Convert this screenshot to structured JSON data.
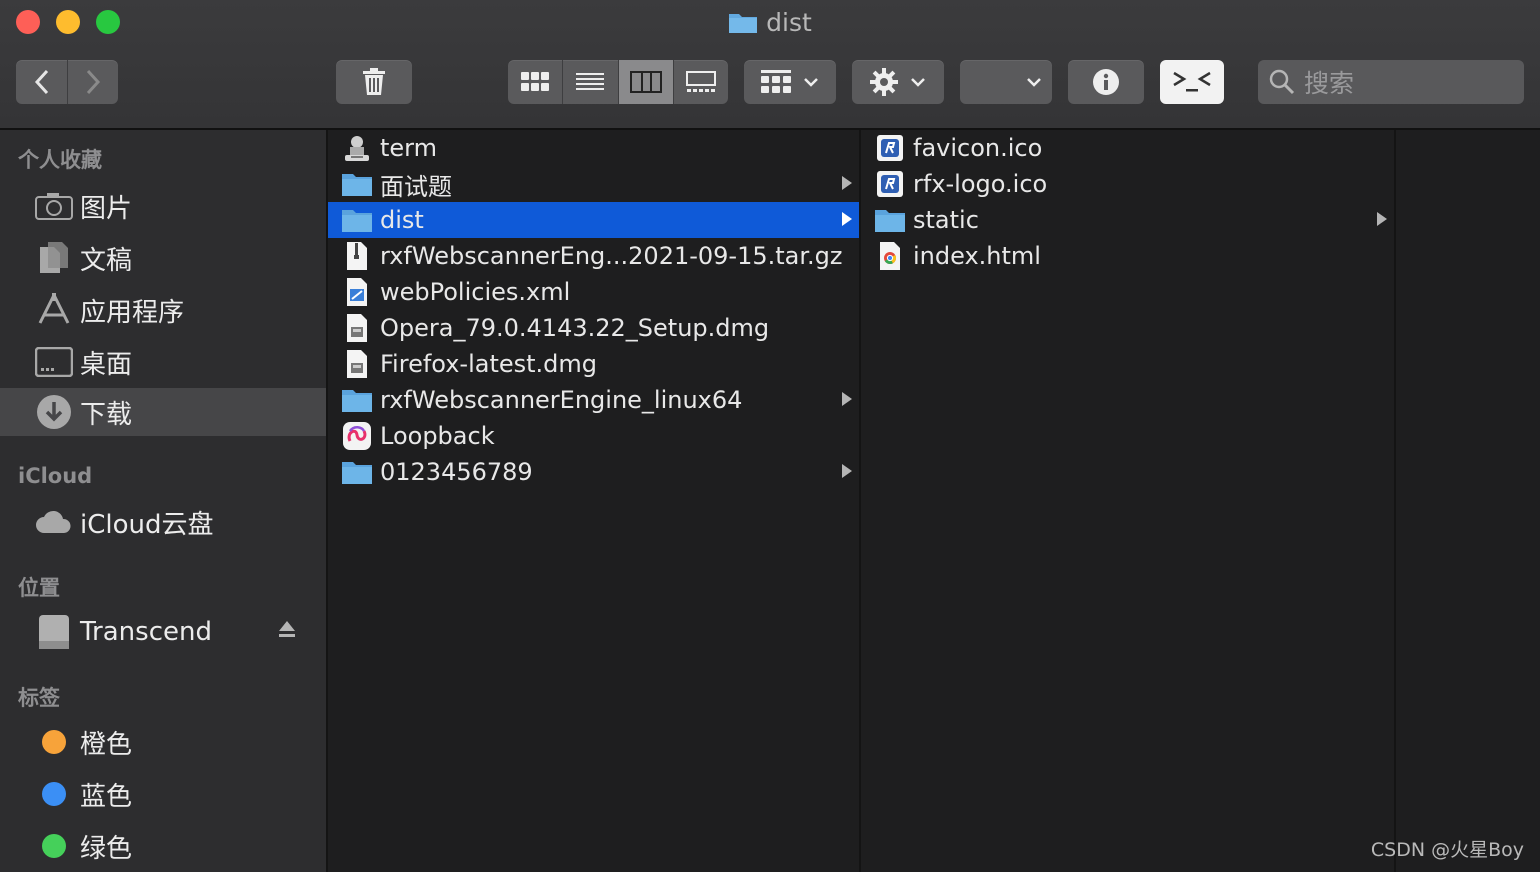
{
  "window": {
    "title": "dist"
  },
  "search": {
    "placeholder": "搜索"
  },
  "sidebar": {
    "sections": [
      {
        "heading": "个人收藏"
      },
      {
        "heading": "iCloud"
      },
      {
        "heading": "位置"
      },
      {
        "heading": "标签"
      }
    ],
    "favorites": [
      {
        "label": "图片",
        "icon": "camera-icon"
      },
      {
        "label": "文稿",
        "icon": "document-icon"
      },
      {
        "label": "应用程序",
        "icon": "applications-icon"
      },
      {
        "label": "桌面",
        "icon": "desktop-icon"
      },
      {
        "label": "下载",
        "icon": "download-icon",
        "selected": true
      }
    ],
    "icloud": [
      {
        "label": "iCloud云盘",
        "icon": "cloud-icon"
      }
    ],
    "locations": [
      {
        "label": "Transcend",
        "icon": "drive-icon"
      }
    ],
    "tags": [
      {
        "label": "橙色",
        "color": "#f7a33a"
      },
      {
        "label": "蓝色",
        "color": "#3b8ff5"
      },
      {
        "label": "绿色",
        "color": "#45d05a"
      }
    ]
  },
  "column1": [
    {
      "name": "term",
      "icon": "terminal-icon"
    },
    {
      "name": "面试题",
      "icon": "folder-icon",
      "expandable": true
    },
    {
      "name": "dist",
      "icon": "folder-icon",
      "expandable": true,
      "selected": true
    },
    {
      "name": "rxfWebscannerEng...2021-09-15.tar.gz",
      "icon": "archive-icon"
    },
    {
      "name": "webPolicies.xml",
      "icon": "xml-file-icon"
    },
    {
      "name": "Opera_79.0.4143.22_Setup.dmg",
      "icon": "disk-image-icon"
    },
    {
      "name": "Firefox-latest.dmg",
      "icon": "disk-image-icon"
    },
    {
      "name": "rxfWebscannerEngine_linux64",
      "icon": "folder-icon",
      "expandable": true
    },
    {
      "name": "Loopback",
      "icon": "loopback-app-icon"
    },
    {
      "name": "0123456789",
      "icon": "folder-icon",
      "expandable": true
    }
  ],
  "column2": [
    {
      "name": "favicon.ico",
      "icon": "ico-file-icon"
    },
    {
      "name": "rfx-logo.ico",
      "icon": "ico-file-icon"
    },
    {
      "name": "static",
      "icon": "folder-icon",
      "expandable": true
    },
    {
      "name": "index.html",
      "icon": "chrome-html-icon"
    }
  ],
  "watermark": "CSDN @火星Boy"
}
